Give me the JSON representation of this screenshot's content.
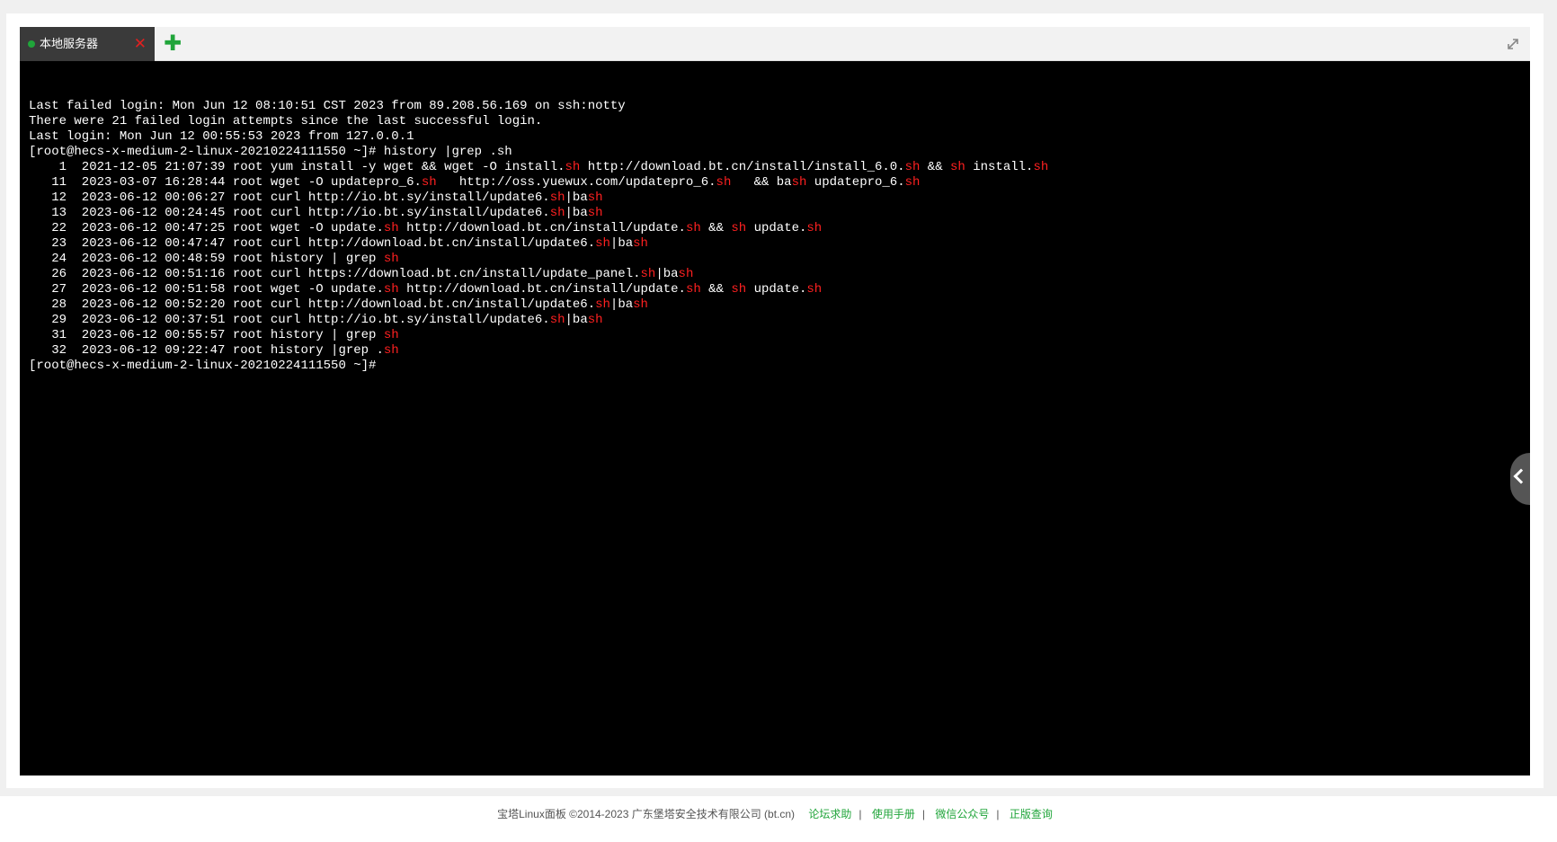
{
  "tab": {
    "label": "本地服务器",
    "close_glyph": "✕",
    "status_color": "#20a53a",
    "add_glyph": "✚"
  },
  "terminal": {
    "background": "#000000",
    "highlight_color": "#ff2020",
    "lines": [
      "Last failed login: Mon Jun 12 08:10:51 CST 2023 from 89.208.56.169 on ssh:notty",
      "There were 21 failed login attempts since the last successful login.",
      "Last login: Mon Jun 12 00:55:53 2023 from 127.0.0.1",
      "[root@hecs-x-medium-2-linux-20210224111550 ~]# history |grep .sh",
      "    1  2021-12-05 21:07:39 root yum install -y wget && wget -O install.sh http://download.bt.cn/install/install_6.0.sh && sh install.sh",
      "   11  2023-03-07 16:28:44 root wget -O updatepro_6.sh   http://oss.yuewux.com/updatepro_6.sh   && bash updatepro_6.sh",
      "   12  2023-06-12 00:06:27 root curl http://io.bt.sy/install/update6.sh|bash",
      "   13  2023-06-12 00:24:45 root curl http://io.bt.sy/install/update6.sh|bash",
      "   22  2023-06-12 00:47:25 root wget -O update.sh http://download.bt.cn/install/update.sh && sh update.sh",
      "   23  2023-06-12 00:47:47 root curl http://download.bt.cn/install/update6.sh|bash",
      "   24  2023-06-12 00:48:59 root history | grep sh",
      "   26  2023-06-12 00:51:16 root curl https://download.bt.cn/install/update_panel.sh|bash",
      "   27  2023-06-12 00:51:58 root wget -O update.sh http://download.bt.cn/install/update.sh && sh update.sh",
      "   28  2023-06-12 00:52:20 root curl http://download.bt.cn/install/update6.sh|bash",
      "   29  2023-06-12 00:37:51 root curl http://io.bt.sy/install/update6.sh|bash",
      "   31  2023-06-12 00:55:57 root history | grep sh",
      "   32  2023-06-12 09:22:47 root history |grep .sh",
      "[root@hecs-x-medium-2-linux-20210224111550 ~]# "
    ]
  },
  "footer": {
    "copyright": "宝塔Linux面板 ©2014-2023 广东堡塔安全技术有限公司 (bt.cn)",
    "links": [
      "论坛求助",
      "使用手册",
      "微信公众号",
      "正版查询"
    ],
    "separator": "|",
    "link_color": "#20a53a"
  }
}
